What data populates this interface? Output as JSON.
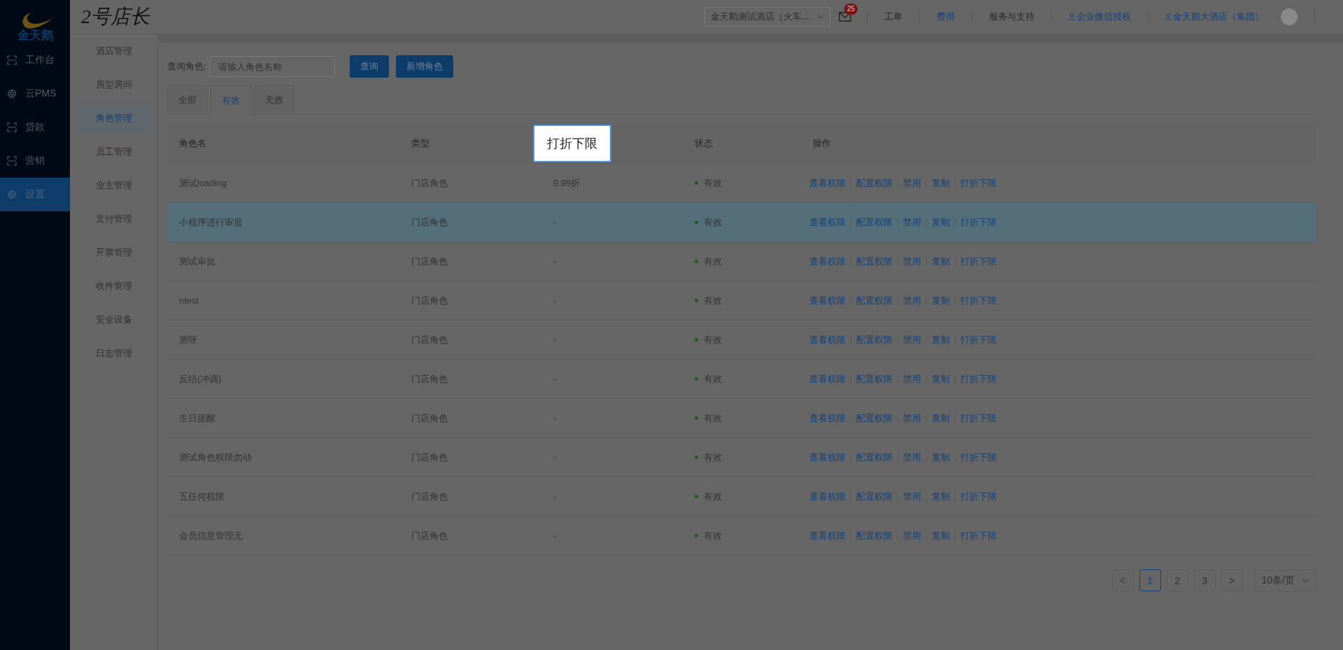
{
  "brand": {
    "logo_text": "金天鹅",
    "app_title": "2号店长"
  },
  "topbar": {
    "hotel_select": "金天鹅测试酒店（火车...",
    "mail_badge": "25",
    "links": [
      {
        "label": "工单",
        "kind": "plain"
      },
      {
        "label": "费用",
        "kind": "link"
      },
      {
        "label": "服务与支持",
        "kind": "plain"
      },
      {
        "label": "企业微信授权",
        "kind": "user"
      },
      {
        "label": "金天鹅大酒店（集团）",
        "kind": "user"
      }
    ]
  },
  "nav": {
    "items": [
      {
        "label": "工作台",
        "kind": "frame",
        "selected": false
      },
      {
        "label": "云PMS",
        "kind": "gear",
        "selected": false
      },
      {
        "label": "贷款",
        "kind": "frame",
        "selected": false
      },
      {
        "label": "营销",
        "kind": "frame",
        "selected": false
      },
      {
        "label": "设置",
        "kind": "gear",
        "selected": true
      }
    ]
  },
  "submenu": {
    "items": [
      {
        "label": "酒店管理",
        "selected": false
      },
      {
        "label": "房型房间",
        "selected": false
      },
      {
        "label": "角色管理",
        "selected": true
      },
      {
        "label": "员工管理",
        "selected": false
      },
      {
        "label": "业主管理",
        "selected": false
      },
      {
        "label": "支付管理",
        "selected": false
      },
      {
        "label": "开票管理",
        "selected": false
      },
      {
        "label": "收件管理",
        "selected": false
      },
      {
        "label": "安全设备",
        "selected": false
      },
      {
        "label": "日志管理",
        "selected": false
      }
    ]
  },
  "search": {
    "label": "查询角色:",
    "placeholder": "请输入角色名称",
    "buttons": [
      "查询",
      "新增角色"
    ]
  },
  "tabs": [
    {
      "label": "全部",
      "selected": false
    },
    {
      "label": "有效",
      "selected": true
    },
    {
      "label": "无效",
      "selected": false
    }
  ],
  "table": {
    "columns": [
      {
        "label": "角色名",
        "highlighted": false
      },
      {
        "label": "类型",
        "highlighted": false
      },
      {
        "label": "打折下限",
        "highlighted": true
      },
      {
        "label": "状态",
        "highlighted": false
      },
      {
        "label": "操作",
        "highlighted": false
      }
    ],
    "rows": [
      {
        "name": "测试loading",
        "type": "门店角色",
        "discount": "9.99折",
        "status": "有效",
        "highlighted": false,
        "actions": [
          "查看权限",
          "配置权限",
          "禁用",
          "复制",
          "打折下限"
        ]
      },
      {
        "name": "小程序进行审批",
        "type": "门店角色",
        "discount": "-",
        "status": "有效",
        "highlighted": true,
        "actions": [
          "查看权限",
          "配置权限",
          "禁用",
          "复制",
          "打折下限"
        ]
      },
      {
        "name": "测试审批",
        "type": "门店角色",
        "discount": "-",
        "status": "有效",
        "highlighted": false,
        "actions": [
          "查看权限",
          "配置权限",
          "禁用",
          "复制",
          "打折下限"
        ]
      },
      {
        "name": "ntest",
        "type": "门店角色",
        "discount": "-",
        "status": "有效",
        "highlighted": false,
        "actions": [
          "查看权限",
          "配置权限",
          "禁用",
          "复制",
          "打折下限"
        ]
      },
      {
        "name": "测呀",
        "type": "门店角色",
        "discount": "-",
        "status": "有效",
        "highlighted": false,
        "actions": [
          "查看权限",
          "配置权限",
          "禁用",
          "复制",
          "打折下限"
        ]
      },
      {
        "name": "反结(冲调)",
        "type": "门店角色",
        "discount": "-",
        "status": "有效",
        "highlighted": false,
        "actions": [
          "查看权限",
          "配置权限",
          "禁用",
          "复制",
          "打折下限"
        ]
      },
      {
        "name": "生日提醒",
        "type": "门店角色",
        "discount": "-",
        "status": "有效",
        "highlighted": false,
        "actions": [
          "查看权限",
          "配置权限",
          "禁用",
          "复制",
          "打折下限"
        ]
      },
      {
        "name": "测试角色权限勿动",
        "type": "门店角色",
        "discount": "-",
        "status": "有效",
        "highlighted": false,
        "actions": [
          "查看权限",
          "配置权限",
          "禁用",
          "复制",
          "打折下限"
        ]
      },
      {
        "name": "五任何权限",
        "type": "门店角色",
        "discount": "-",
        "status": "有效",
        "highlighted": false,
        "actions": [
          "查看权限",
          "配置权限",
          "禁用",
          "复制",
          "打折下限"
        ]
      },
      {
        "name": "会员信息管理无",
        "type": "门店角色",
        "discount": "-",
        "status": "有效",
        "highlighted": false,
        "actions": [
          "查看权限",
          "配置权限",
          "禁用",
          "复制",
          "打折下限"
        ]
      }
    ]
  },
  "pagination": {
    "prev": "<",
    "pages": [
      {
        "label": "1",
        "selected": true
      },
      {
        "label": "2",
        "selected": false
      },
      {
        "label": "3",
        "selected": false
      }
    ],
    "next": ">",
    "page_size": "10条/页"
  }
}
